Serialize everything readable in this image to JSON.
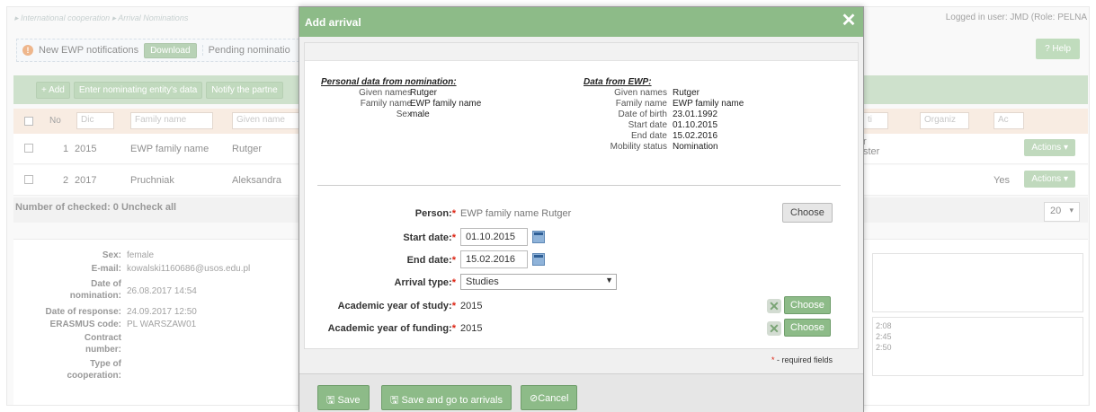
{
  "breadcrumb": [
    "International cooperation",
    "Arrival Nominations"
  ],
  "logged_in": "Logged in user: JMD (Role: PELNA",
  "notifications": {
    "label": "New EWP notifications",
    "download": "Download",
    "pending": "Pending nominatio"
  },
  "help": "? Help",
  "toolbar": {
    "add": "+ Add",
    "enter_entity": "Enter nominating entity's data",
    "notify": "Notify the partne"
  },
  "table": {
    "headers": {
      "no": "No",
      "dic": "Dic",
      "family_name": "Family name",
      "given_names": "Given name",
      "ti": "ti",
      "organiz": "Organiz",
      "ac": "Ac"
    },
    "rows": [
      {
        "no": "1",
        "year": "2015",
        "family": "EWP family name",
        "given": "Rutger",
        "partial": "r\nster",
        "yes": "",
        "actions": "Actions"
      },
      {
        "no": "2",
        "year": "2017",
        "family": "Pruchniak",
        "given": "Aleksandra",
        "partial": "",
        "yes": "Yes",
        "actions": "Actions"
      }
    ]
  },
  "checked_bar": "Number of checked: 0 Uncheck all",
  "pager": "20",
  "details": {
    "sex_label": "Sex:",
    "sex": "female",
    "email_label": "E-mail:",
    "email": "kowalski1160686@usos.edu.pl",
    "date_nom_label": "Date of nomination:",
    "date_nom": "26.08.2017 14:54",
    "date_resp_label": "Date of response:",
    "date_resp": "24.09.2017 12:50",
    "erasmus_label": "ERASMUS code:",
    "erasmus": "PL WARSZAW01",
    "contract_label": "Contract number:",
    "coop_label": "Type of cooperation:",
    "times": [
      "2:08",
      "2:45",
      "2:50"
    ]
  },
  "modal": {
    "title": "Add arrival",
    "personal_title": "Personal data from nomination:",
    "personal": {
      "given_label": "Given names",
      "given": "Rutger",
      "family_label": "Family name",
      "family": "EWP family name",
      "sex_label": "Sex",
      "sex": "male"
    },
    "ewp_title": "Data from EWP:",
    "ewp": {
      "given_label": "Given names",
      "given": "Rutger",
      "family_label": "Family name",
      "family": "EWP family name",
      "dob_label": "Date of birth",
      "dob": "23.01.1992",
      "start_label": "Start date",
      "start": "01.10.2015",
      "end_label": "End date",
      "end": "15.02.2016",
      "status_label": "Mobility status",
      "status": "Nomination"
    },
    "form": {
      "person_label": "Person:",
      "person": "EWP family name Rutger",
      "choose": "Choose",
      "start_label": "Start date:",
      "start": "01.10.2015",
      "end_label": "End date:",
      "end": "15.02.2016",
      "arrival_label": "Arrival type:",
      "arrival": "Studies",
      "study_year_label": "Academic year of study:",
      "study_year": "2015",
      "funding_year_label": "Academic year of funding:",
      "funding_year": "2015"
    },
    "required_note": "- required fields",
    "save": "Save",
    "save_go": "Save and go to arrivals",
    "cancel": "Cancel"
  }
}
